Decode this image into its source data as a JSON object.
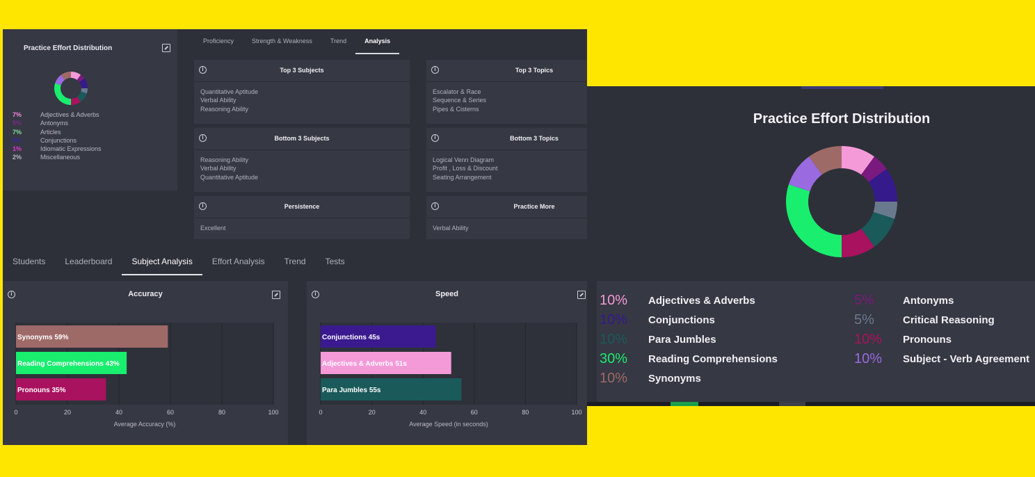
{
  "effort_panel": {
    "title": "Practice Effort Distribution",
    "legend": [
      {
        "pct": "7%",
        "label": "Adjectives & Adverbs",
        "color": "#f08ad8"
      },
      {
        "pct": "5%",
        "label": "Antonyms",
        "color": "#7a2a8c"
      },
      {
        "pct": "7%",
        "label": "Articles",
        "color": "#7ee09a"
      },
      {
        "pct": "5%",
        "label": "Conjunctions",
        "color": "#3a2a9c"
      },
      {
        "pct": "1%",
        "label": "Idiomatic Expressions",
        "color": "#e23ad8"
      },
      {
        "pct": "2%",
        "label": "Miscellaneous",
        "color": "#b9b9c4"
      }
    ]
  },
  "analysis_tabs": [
    "Proficiency",
    "Strength & Weakness",
    "Trend",
    "Analysis"
  ],
  "analysis_active": 3,
  "cards": [
    {
      "title": "Top 3 Subjects",
      "items": [
        "Quantitative Aptitude",
        "Verbal Ability",
        "Reasoning Ability"
      ]
    },
    {
      "title": "Top 3 Topics",
      "items": [
        "Escalator & Race",
        "Sequence & Series",
        "Pipes & Cisterns"
      ]
    },
    {
      "title": "Bottom 3 Subjects",
      "items": [
        "Reasoning Ability",
        "Verbal Ability",
        "Quantitative Aptitude"
      ]
    },
    {
      "title": "Bottom 3 Topics",
      "items": [
        "Logical Venn Diagram",
        "Profit , Loss & Discount",
        "Seating Arrangement"
      ]
    },
    {
      "title": "Persistence",
      "items": [
        "Excellent"
      ]
    },
    {
      "title": "Practice More",
      "items": [
        "Verbal Ability"
      ]
    }
  ],
  "main_tabs": [
    "Students",
    "Leaderboard",
    "Subject Analysis",
    "Effort Analysis",
    "Trend",
    "Tests"
  ],
  "main_active": 2,
  "chart_data": [
    {
      "type": "bar",
      "orientation": "horizontal",
      "title": "Accuracy",
      "xlabel": "Average Accuracy (%)",
      "xlim": [
        0,
        100
      ],
      "xticks": [
        "0",
        "20",
        "40",
        "60",
        "80",
        "100"
      ],
      "categories": [
        "Synonyms",
        "Reading Comprehensions",
        "Pronouns"
      ],
      "values": [
        59,
        43,
        35
      ],
      "labels": [
        "Synonyms 59%",
        "Reading Comprehensions 43%",
        "Pronouns 35%"
      ],
      "colors": [
        "#9e6a68",
        "#19ee6e",
        "#a8125f"
      ]
    },
    {
      "type": "bar",
      "orientation": "horizontal",
      "title": "Speed",
      "xlabel": "Average Speed (in seconds)",
      "xlim": [
        0,
        100
      ],
      "xticks": [
        "0",
        "20",
        "40",
        "60",
        "80",
        "100"
      ],
      "categories": [
        "Conjunctions",
        "Adjectives & Adverbs",
        "Para Jumbles"
      ],
      "values": [
        45,
        51,
        55
      ],
      "labels": [
        "Conjunctions 45s",
        "Adjectives & Adverbs 51s",
        "Para Jumbles 55s"
      ],
      "colors": [
        "#3a1a8e",
        "#f59ad9",
        "#1a5a5a"
      ]
    },
    {
      "type": "pie",
      "donut": true,
      "title": "Practice Effort Distribution",
      "categories": [
        "Adjectives & Adverbs",
        "Antonyms",
        "Conjunctions",
        "Critical Reasoning",
        "Para Jumbles",
        "Pronouns",
        "Reading Comprehensions",
        "Subject - Verb Agreement",
        "Synonyms"
      ],
      "values": [
        10,
        5,
        10,
        5,
        10,
        10,
        30,
        10,
        10
      ],
      "labels": [
        "10%",
        "5%",
        "10%",
        "5%",
        "10%",
        "10%",
        "30%",
        "10%",
        "10%"
      ],
      "colors": [
        "#f59ad9",
        "#7a1a7e",
        "#351a8c",
        "#6a7a8e",
        "#1a5a5a",
        "#a8125f",
        "#19ee6e",
        "#9a6ae0",
        "#9e6a68"
      ]
    }
  ]
}
